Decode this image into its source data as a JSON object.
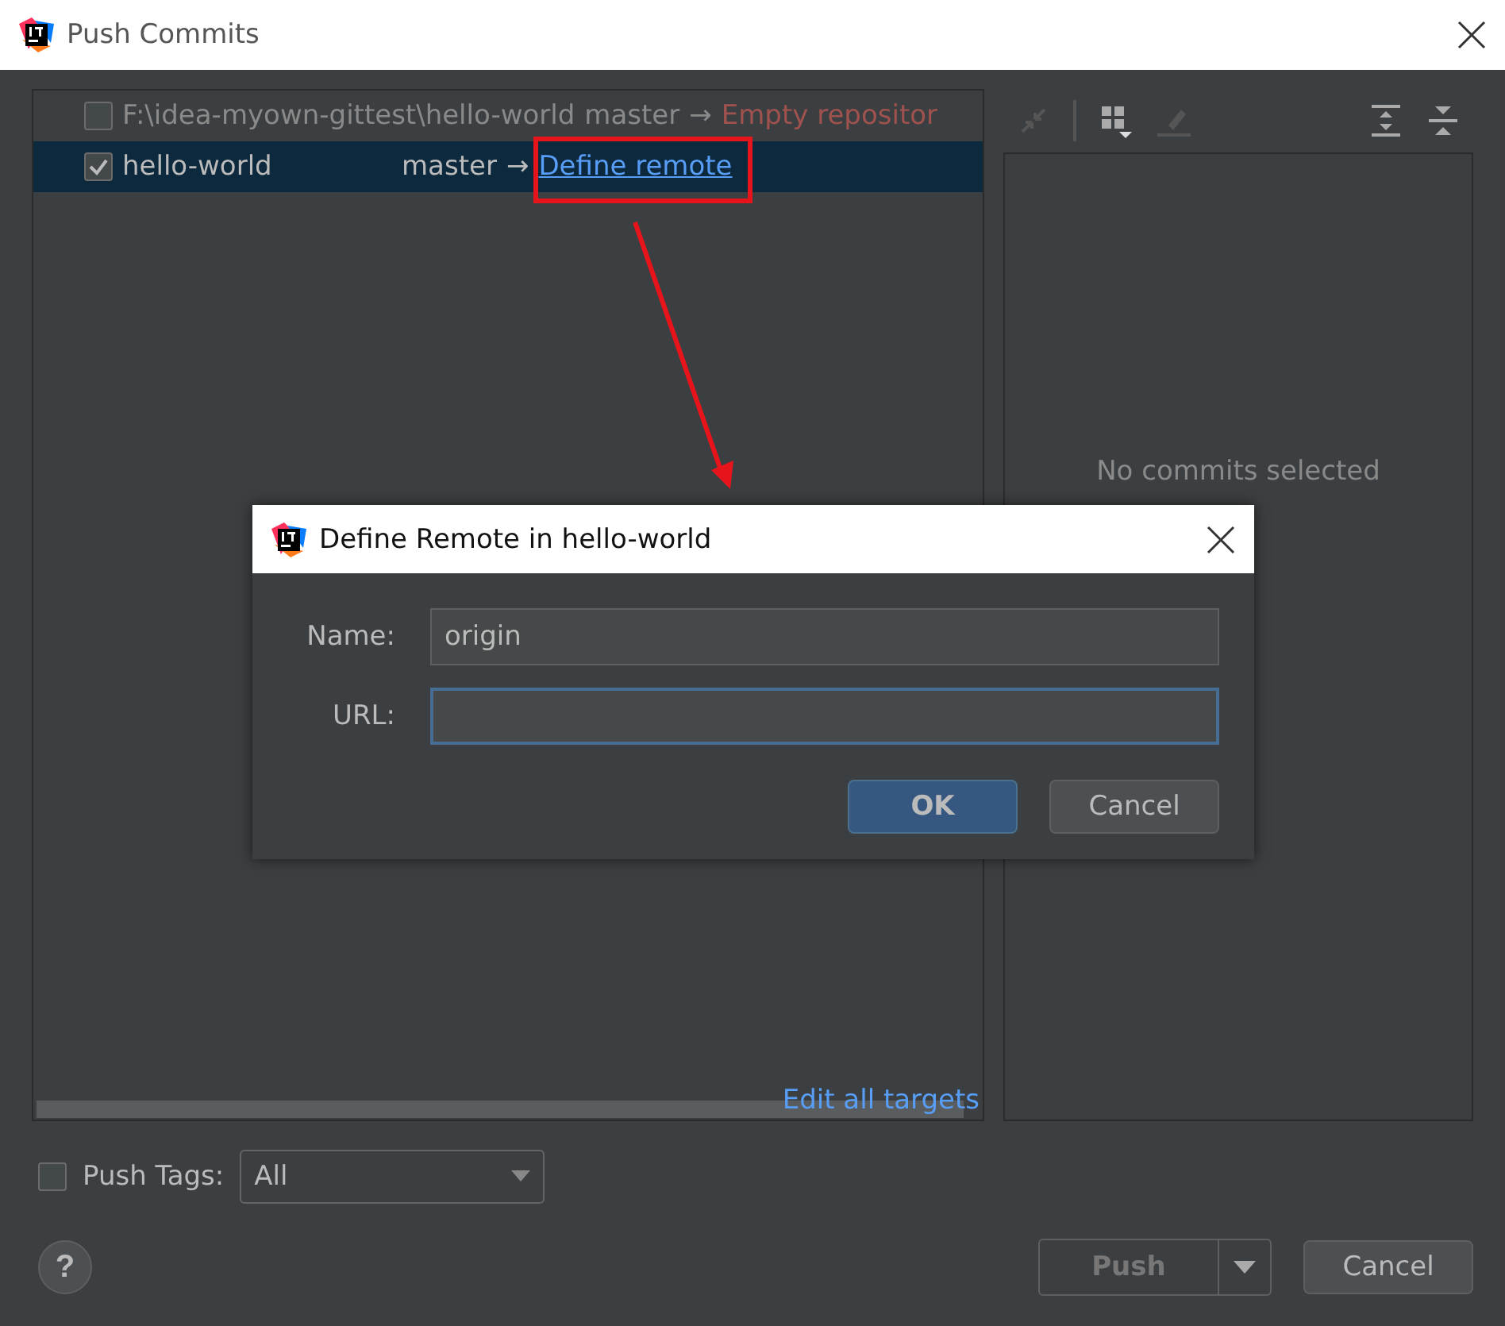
{
  "window": {
    "title": "Push Commits"
  },
  "repositories": [
    {
      "name": "F:\\idea-myown-gittest\\hello-world",
      "checked": false,
      "selected": false,
      "branch": "master",
      "arrow": "→",
      "target": "Empty repositor",
      "kind": "error"
    },
    {
      "name": "hello-world",
      "checked": true,
      "selected": true,
      "branch": "master",
      "arrow": "→",
      "target": "Define remote",
      "kind": "link"
    }
  ],
  "edit_targets_link": "Edit all targets",
  "details": {
    "empty_text": "No commits selected"
  },
  "push_tags": {
    "label": "Push Tags:",
    "checked": false,
    "value": "All"
  },
  "buttons": {
    "help": "?",
    "push": "Push",
    "push_disabled": true,
    "cancel": "Cancel"
  },
  "dialog": {
    "title": "Define Remote in hello-world",
    "fields": [
      {
        "label": "Name:",
        "value": "origin",
        "focused": false
      },
      {
        "label": "URL:",
        "focused": true
      }
    ],
    "ok": "OK",
    "cancel": "Cancel"
  }
}
